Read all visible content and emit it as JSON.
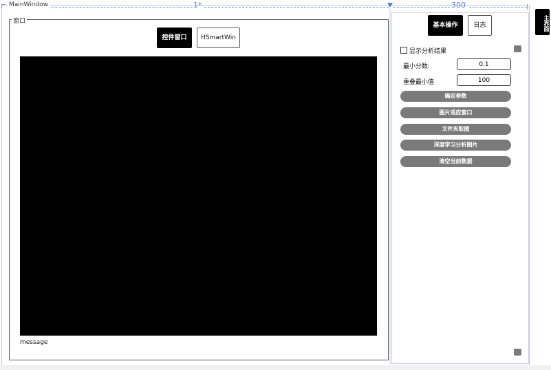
{
  "window": {
    "title": "MainWindow"
  },
  "designer": {
    "column_star": "1*",
    "column_width": "300"
  },
  "left_group": {
    "label": "窗口",
    "tabs": [
      {
        "label": "控件窗口",
        "active": true
      },
      {
        "label": "HSmartWin",
        "active": false
      }
    ],
    "message": "message"
  },
  "right_panel": {
    "tabs": [
      {
        "label": "基本操作",
        "active": true
      },
      {
        "label": "日志",
        "active": false
      }
    ],
    "show_result_label": "显示分析结果",
    "min_score_label": "最小分数:",
    "min_score_value": "0.1",
    "overlap_label": "重叠最小值",
    "overlap_value": "100",
    "buttons": [
      "确定参数",
      "图片适应窗口",
      "文件夹取图",
      "深度学习分析图片",
      "清空当前数据"
    ]
  },
  "side_tab": {
    "label": "主界面"
  }
}
